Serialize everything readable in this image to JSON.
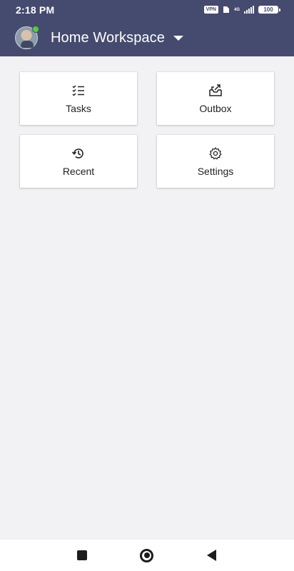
{
  "status_bar": {
    "time": "2:18 PM",
    "vpn_label": "VPN",
    "network_label": "4G",
    "battery": "100"
  },
  "app_bar": {
    "workspace_title": "Home Workspace",
    "presence_color": "#4cd137",
    "background_color": "#454b6e"
  },
  "tiles": [
    {
      "label": "Tasks",
      "icon": "checklist-icon"
    },
    {
      "label": "Outbox",
      "icon": "outbox-icon"
    },
    {
      "label": "Recent",
      "icon": "history-icon"
    },
    {
      "label": "Settings",
      "icon": "gear-icon"
    }
  ],
  "nav_bar": {
    "recents": "square-icon",
    "home": "circle-icon",
    "back": "triangle-back-icon"
  }
}
